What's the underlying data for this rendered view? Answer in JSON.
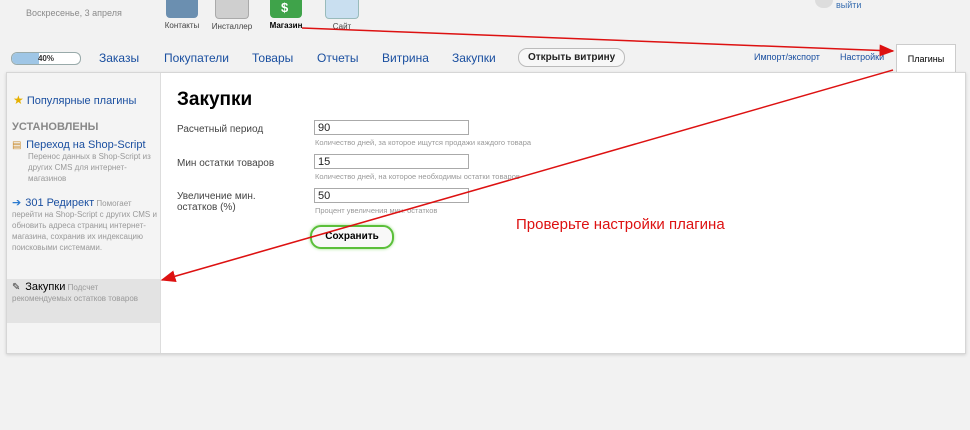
{
  "header": {
    "date": "Воскресенье, 3 апреля",
    "apps": [
      {
        "label": "Контакты",
        "icon": "contacts-icon",
        "color": "#6b8fb0"
      },
      {
        "label": "Инсталлер",
        "icon": "installer-icon",
        "color": "#cfcfcf"
      },
      {
        "label": "Магазин",
        "icon": "shop-basket-icon",
        "color": "#3fa34a"
      },
      {
        "label": "Сайт",
        "icon": "site-icon",
        "color": "#c9dff0"
      }
    ],
    "logout": "выйти"
  },
  "nav": {
    "progress": "40%",
    "progress_value": 0.4,
    "links": [
      "Заказы",
      "Покупатели",
      "Товары",
      "Отчеты",
      "Витрина",
      "Закупки"
    ],
    "storefront_button": "Открыть витрину",
    "import_export": "Импорт/экспорт",
    "settings": "Настройки",
    "plugins_tab": "Плагины"
  },
  "sidebar": {
    "popular": "Популярные плагины",
    "installed_heading": "УСТАНОВЛЕНЫ",
    "plugins": [
      {
        "title": "Переход на Shop-Script",
        "desc": "Перенос данных в Shop-Script из других CMS для интернет-магазинов",
        "icon": "migrate-icon"
      },
      {
        "title": "301 Редирект",
        "desc": "Помогает перейти на Shop-Script с других CMS и обновить адреса страниц интернет-магазина, сохранив их индексацию поисковыми системами.",
        "icon": "redirect-arrow-icon"
      },
      {
        "title": "Закупки",
        "desc": "Подсчет рекомендуемых остатков товаров",
        "icon": "wrench-icon"
      }
    ]
  },
  "form": {
    "title": "Закупки",
    "fields": [
      {
        "label": "Расчетный период",
        "value": "90",
        "hint": "Количество дней, за которое ищутся продажи каждого товара"
      },
      {
        "label": "Мин остатки товаров",
        "value": "15",
        "hint": "Количество дней, на которое необходимы остатки товаров"
      },
      {
        "label": "Увеличение мин. остатков (%)",
        "value": "50",
        "hint": "Процент увеличения мин. остатков"
      }
    ],
    "save": "Сохранить"
  },
  "annotation": {
    "text": "Проверьте настройки плагина",
    "color": "#dd1111"
  }
}
